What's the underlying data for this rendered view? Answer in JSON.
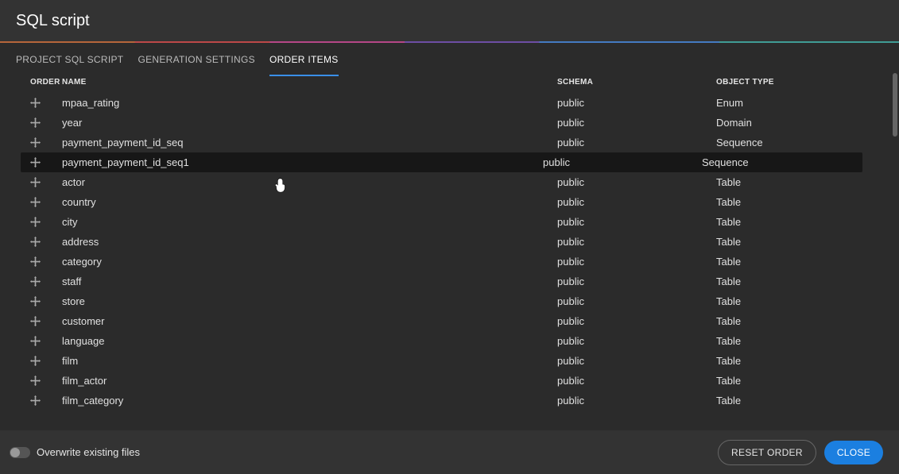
{
  "header": {
    "title": "SQL script"
  },
  "tabs": [
    {
      "label": "PROJECT SQL SCRIPT",
      "active": false
    },
    {
      "label": "GENERATION SETTINGS",
      "active": false
    },
    {
      "label": "ORDER ITEMS",
      "active": true
    }
  ],
  "columns": {
    "order": "ORDER",
    "name": "NAME",
    "schema": "SCHEMA",
    "type": "OBJECT TYPE"
  },
  "rows": [
    {
      "name": "mpaa_rating",
      "schema": "public",
      "type": "Enum",
      "highlight": false
    },
    {
      "name": "year",
      "schema": "public",
      "type": "Domain",
      "highlight": false
    },
    {
      "name": "payment_payment_id_seq",
      "schema": "public",
      "type": "Sequence",
      "highlight": false
    },
    {
      "name": "payment_payment_id_seq1",
      "schema": "public",
      "type": "Sequence",
      "highlight": true
    },
    {
      "name": "actor",
      "schema": "public",
      "type": "Table",
      "highlight": false
    },
    {
      "name": "country",
      "schema": "public",
      "type": "Table",
      "highlight": false
    },
    {
      "name": "city",
      "schema": "public",
      "type": "Table",
      "highlight": false
    },
    {
      "name": "address",
      "schema": "public",
      "type": "Table",
      "highlight": false
    },
    {
      "name": "category",
      "schema": "public",
      "type": "Table",
      "highlight": false
    },
    {
      "name": "staff",
      "schema": "public",
      "type": "Table",
      "highlight": false
    },
    {
      "name": "store",
      "schema": "public",
      "type": "Table",
      "highlight": false
    },
    {
      "name": "customer",
      "schema": "public",
      "type": "Table",
      "highlight": false
    },
    {
      "name": "language",
      "schema": "public",
      "type": "Table",
      "highlight": false
    },
    {
      "name": "film",
      "schema": "public",
      "type": "Table",
      "highlight": false
    },
    {
      "name": "film_actor",
      "schema": "public",
      "type": "Table",
      "highlight": false
    },
    {
      "name": "film_category",
      "schema": "public",
      "type": "Table",
      "highlight": false
    }
  ],
  "footer": {
    "overwrite_label": "Overwrite existing files",
    "reset_label": "RESET ORDER",
    "close_label": "CLOSE"
  }
}
